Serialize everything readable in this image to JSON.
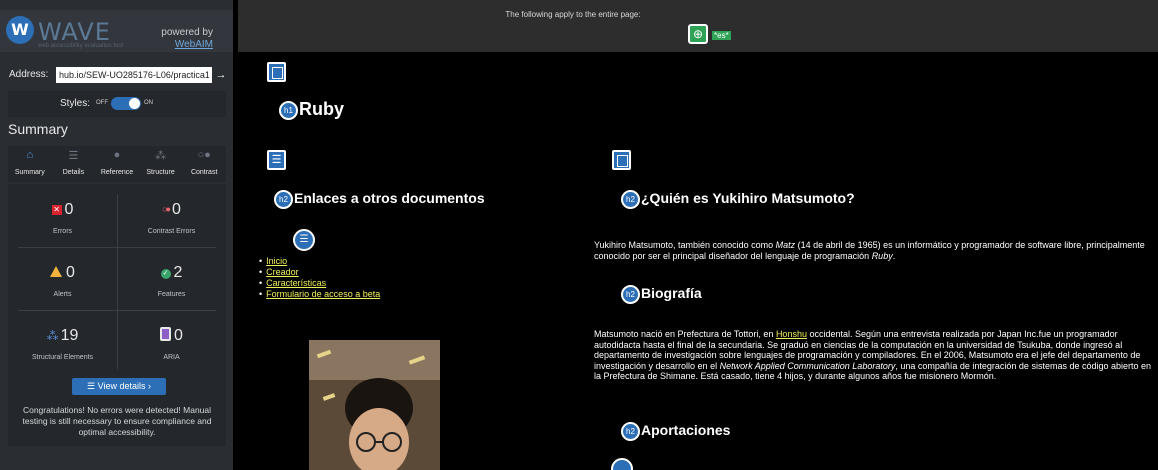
{
  "wave": {
    "logo_glyph": "W",
    "wordmark": "WAVE",
    "tagline": "web accessibility evaluation tool",
    "powered_by": "powered by",
    "webaim": "WebAIM",
    "address_label": "Address:",
    "address_value": "hub.io/SEW-UO285176-L06/practica1/autor.h",
    "go_glyph": "→",
    "styles_label": "Styles:",
    "styles_off": "OFF",
    "styles_on": "ON",
    "styles_enabled": true,
    "summary_title": "Summary",
    "tabs": [
      {
        "label": "Summary",
        "icon": "home-icon",
        "glyph": "⌂",
        "active": true
      },
      {
        "label": "Details",
        "icon": "list-icon",
        "glyph": "☰",
        "active": false
      },
      {
        "label": "Reference",
        "icon": "info-icon",
        "glyph": "●",
        "active": false
      },
      {
        "label": "Structure",
        "icon": "structure-icon",
        "glyph": "⁂",
        "active": false
      },
      {
        "label": "Contrast",
        "icon": "contrast-icon",
        "glyph": "○●",
        "active": false
      }
    ],
    "stats": {
      "errors": {
        "value": "0",
        "label": "Errors",
        "icon": "error-icon"
      },
      "contrast_errors": {
        "value": "0",
        "label": "Contrast Errors",
        "icon": "contrast-error-icon"
      },
      "alerts": {
        "value": "0",
        "label": "Alerts",
        "icon": "alert-icon"
      },
      "features": {
        "value": "2",
        "label": "Features",
        "icon": "feature-icon"
      },
      "structural": {
        "value": "19",
        "label": "Structural Elements",
        "icon": "structure-icon"
      },
      "aria": {
        "value": "0",
        "label": "ARIA",
        "icon": "aria-icon"
      }
    },
    "view_details": "☰  View details ›",
    "congrats": "Congratulations! No errors were detected! Manual testing is still necessary to ensure compliance and optimal accessibility.",
    "colors": {
      "accent": "#2c6fb7",
      "error": "#d9232e",
      "alert": "#f0b23c",
      "feature": "#3aa56a",
      "aria": "#8b5fc7"
    }
  },
  "page": {
    "top_bar_text": "The following apply to the entire page:",
    "lang_tag": "*es*",
    "h1": "Ruby",
    "h_badge_1": "h1",
    "h_badge_2": "h2",
    "list_badge": "☰",
    "h2_enlaces": "Enlaces a otros documentos",
    "nav": [
      "Inicio",
      "Creador",
      "Características",
      "Formulario de acceso a beta"
    ],
    "h2_quien": "¿Quién es Yukihiro Matsumoto?",
    "quien_p1": "Yukihiro Matsumoto, también conocido como ",
    "quien_matz": "Matz",
    "quien_p2": " (14 de abril de 1965) es un informático y programador de software libre, principalmente conocido por ser el principal diseñador del lenguaje de programación ",
    "quien_ruby": "Ruby",
    "quien_p3": ".",
    "h2_biografia": "Biografía",
    "bio_p1": "Matsumoto nació en Prefectura de Tottori, en ",
    "bio_link": "Honshu",
    "bio_p2": " occidental. Según una entrevista realizada por Japan Inc.fue un programador autodidacta hasta el final de la secundaria. Se graduó en ciencias de la computación en la universidad de Tsukuba, donde ingresó al departamento de investigación sobre lenguajes de programación y compiladores. En el 2006, Matsumoto era el jefe del departamento de investigación y desarrollo en el ",
    "bio_em": "Network Applied Communication Laboratory",
    "bio_p3": ", una compañía de integración de sistemas de código abierto en la Prefectura de Shimane. Está casado, tiene 4 hijos, y durante algunos años fue misionero Mormón.",
    "h2_aportaciones": "Aportaciones"
  }
}
